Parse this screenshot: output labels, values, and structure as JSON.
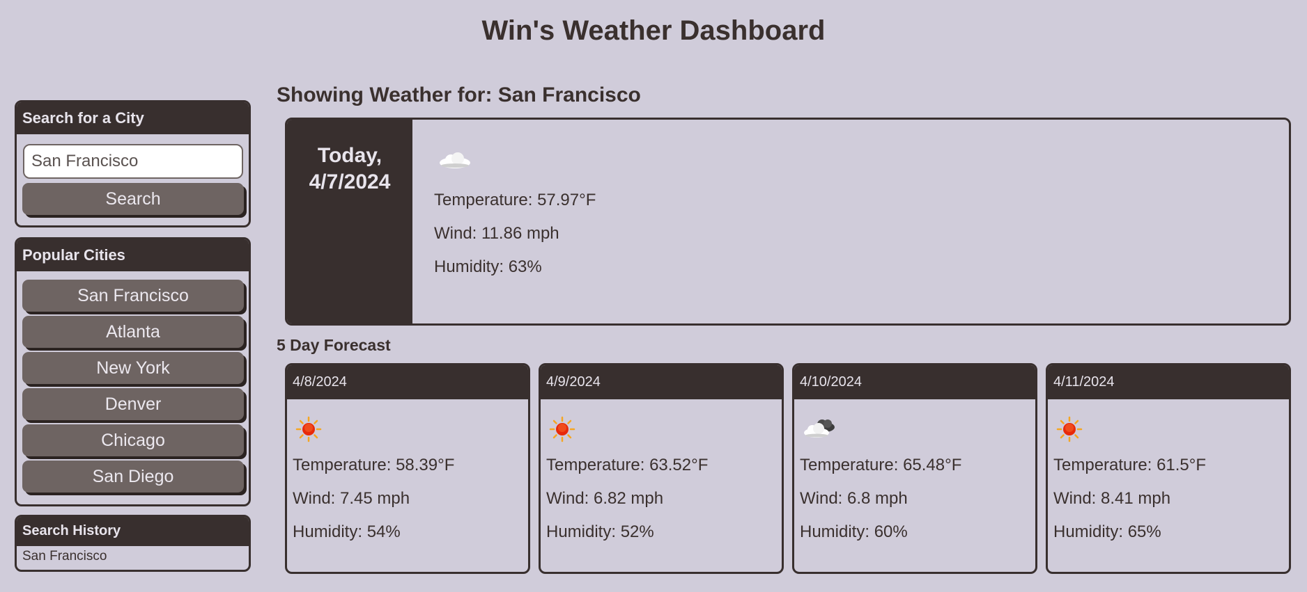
{
  "header": {
    "title": "Win's Weather Dashboard"
  },
  "search": {
    "title": "Search for a City",
    "input_value": "San Francisco",
    "button_label": "Search"
  },
  "popular": {
    "title": "Popular Cities",
    "cities": [
      "San Francisco",
      "Atlanta",
      "New York",
      "Denver",
      "Chicago",
      "San Diego"
    ]
  },
  "history": {
    "title": "Search History",
    "items": [
      "San Francisco"
    ]
  },
  "current": {
    "heading": "Showing Weather for: San Francisco",
    "date_line1": "Today,",
    "date_line2": "4/7/2024",
    "icon": "cloud-icon",
    "temperature": "Temperature: 57.97°F",
    "wind": "Wind: 11.86 mph",
    "humidity": "Humidity: 63%"
  },
  "forecast": {
    "title": "5 Day Forecast",
    "days": [
      {
        "date": "4/8/2024",
        "icon": "sun-icon",
        "temperature": "Temperature: 58.39°F",
        "wind": "Wind: 7.45 mph",
        "humidity": "Humidity: 54%"
      },
      {
        "date": "4/9/2024",
        "icon": "sun-icon",
        "temperature": "Temperature: 63.52°F",
        "wind": "Wind: 6.82 mph",
        "humidity": "Humidity: 52%"
      },
      {
        "date": "4/10/2024",
        "icon": "broken-clouds-icon",
        "temperature": "Temperature: 65.48°F",
        "wind": "Wind: 6.8 mph",
        "humidity": "Humidity: 60%"
      },
      {
        "date": "4/11/2024",
        "icon": "sun-icon",
        "temperature": "Temperature: 61.5°F",
        "wind": "Wind: 8.41 mph",
        "humidity": "Humidity: 65%"
      }
    ]
  },
  "colors": {
    "background": "#d0ccda",
    "dark": "#382f2e",
    "button": "#6e6462"
  }
}
